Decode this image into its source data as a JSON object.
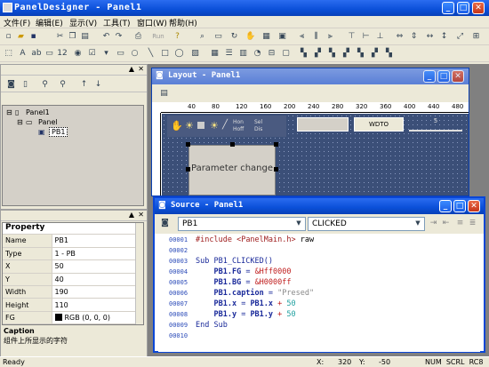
{
  "app": {
    "title": "PanelDesigner - Panel1"
  },
  "menu": [
    "文件(F)",
    "编辑(E)",
    "显示(V)",
    "工具(T)",
    "窗口(W)",
    "帮助(H)"
  ],
  "toolbar": {
    "run_label": "Run"
  },
  "tree": {
    "root": "Panel1",
    "child": "Panel",
    "leaf": "PB1"
  },
  "property": {
    "header": "Property",
    "rows": [
      {
        "k": "Name",
        "v": "PB1"
      },
      {
        "k": "Type",
        "v": "1 - PB"
      },
      {
        "k": "X",
        "v": "50"
      },
      {
        "k": "Y",
        "v": "40"
      },
      {
        "k": "Width",
        "v": "190"
      },
      {
        "k": "Height",
        "v": "110"
      },
      {
        "k": "FG",
        "v": "RGB (0, 0, 0)"
      }
    ],
    "desc_title": "Caption",
    "desc_text": "组件上所显示的字符"
  },
  "layout": {
    "title": "Layout - Panel1",
    "ruler": [
      "40",
      "80",
      "120",
      "160",
      "200",
      "240",
      "280",
      "320",
      "360",
      "400",
      "440",
      "480"
    ],
    "button_caption": "Parameter change",
    "widget_text": "WDTO",
    "widget_small": "5",
    "lamp_labels": [
      "Hon",
      "Hoff",
      "Sel",
      "Dis"
    ]
  },
  "source": {
    "title": "Source - Panel1",
    "object": "PB1",
    "event": "CLICKED",
    "lines": [
      {
        "n": "00001",
        "t": "#include <PanelMain.h> raw"
      },
      {
        "n": "00002",
        "t": ""
      },
      {
        "n": "00003",
        "t": "Sub PB1_CLICKED()"
      },
      {
        "n": "00004",
        "t": "    PB1.FG = &Hff0000"
      },
      {
        "n": "00005",
        "t": "    PB1.BG = &H0000ff"
      },
      {
        "n": "00006",
        "t": "    PB1.caption = \"Presed\""
      },
      {
        "n": "00007",
        "t": "    PB1.x = PB1.x + 50"
      },
      {
        "n": "00008",
        "t": "    PB1.y = PB1.y + 50"
      },
      {
        "n": "00009",
        "t": "End Sub"
      },
      {
        "n": "00010",
        "t": ""
      }
    ]
  },
  "status": {
    "ready": "Ready",
    "x_label": "X:",
    "x": "320",
    "y_label": "Y:",
    "y": "-50",
    "keys": "NUM  SCRL  RC8"
  }
}
